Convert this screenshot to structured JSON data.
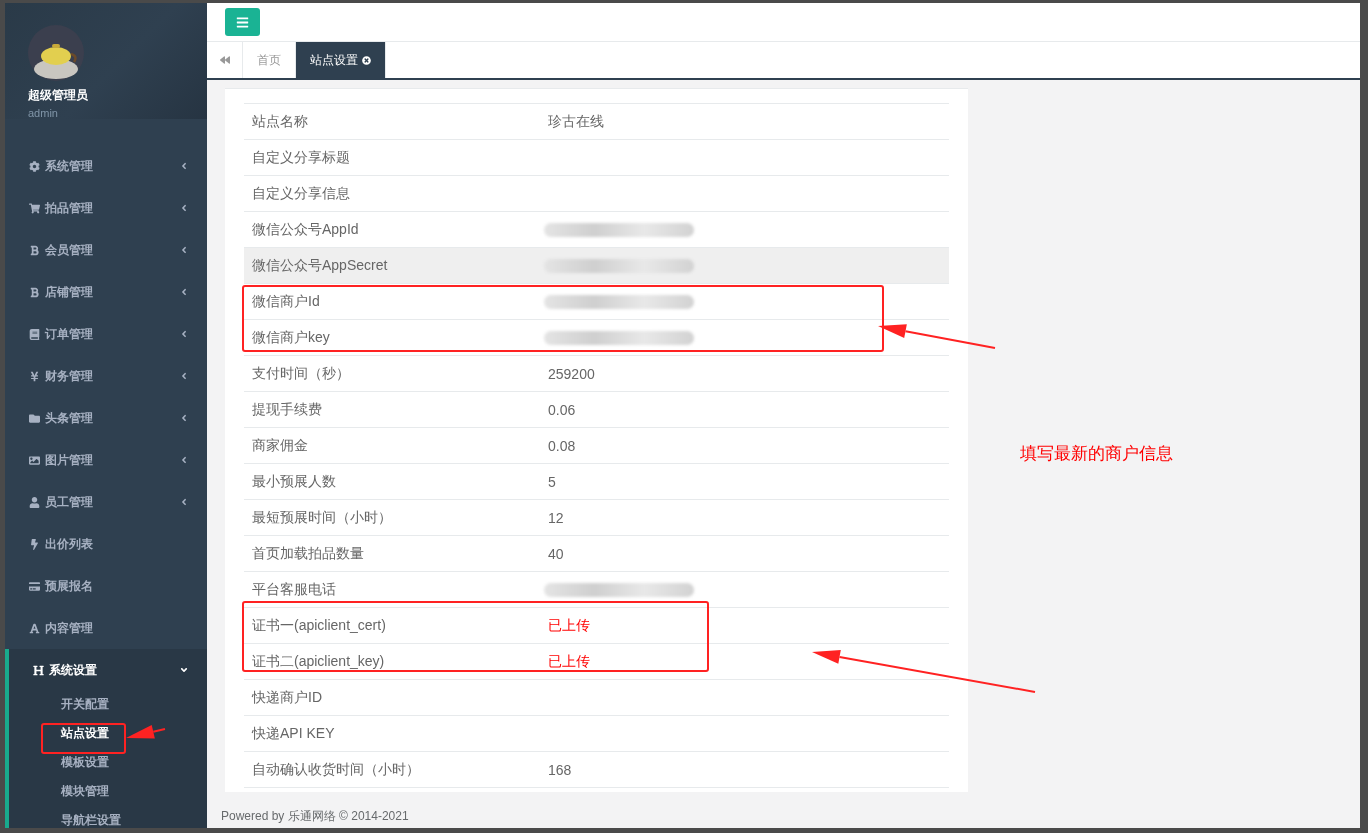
{
  "sidebar": {
    "profile": {
      "name": "超级管理员",
      "role": "admin"
    },
    "menu": [
      {
        "label": "系统管理",
        "expanded": false
      },
      {
        "label": "拍品管理",
        "expanded": false
      },
      {
        "label": "会员管理",
        "expanded": false
      },
      {
        "label": "店铺管理",
        "expanded": false
      },
      {
        "label": "订单管理",
        "expanded": false
      },
      {
        "label": "财务管理",
        "expanded": false
      },
      {
        "label": "头条管理",
        "expanded": false
      },
      {
        "label": "图片管理",
        "expanded": false
      },
      {
        "label": "员工管理",
        "expanded": false
      },
      {
        "label": "出价列表"
      },
      {
        "label": "预展报名"
      },
      {
        "label": "内容管理"
      },
      {
        "label": "系统设置",
        "expanded": true,
        "children": [
          {
            "label": "开关配置",
            "selected": false
          },
          {
            "label": "站点设置",
            "selected": true
          },
          {
            "label": "模板设置",
            "selected": false
          },
          {
            "label": "模块管理",
            "selected": false
          },
          {
            "label": "导航栏设置",
            "selected": false
          }
        ]
      }
    ]
  },
  "tabs": [
    {
      "label": "首页",
      "selected": false,
      "closable": false
    },
    {
      "label": "站点设置",
      "selected": true,
      "closable": true
    }
  ],
  "rows": [
    {
      "label": "站点名称",
      "value": "珍古在线",
      "kind": "text",
      "hover": false
    },
    {
      "label": "自定义分享标题",
      "kind": "empty",
      "hover": false
    },
    {
      "label": "自定义分享信息",
      "kind": "empty",
      "hover": false
    },
    {
      "label": "微信公众号AppId",
      "kind": "redacted",
      "hover": false
    },
    {
      "label": "微信公众号AppSecret",
      "kind": "redacted",
      "hover": true
    },
    {
      "label": "微信商户Id",
      "kind": "redacted",
      "hover": false
    },
    {
      "label": "微信商户key",
      "kind": "redacted",
      "hover": false
    },
    {
      "label": "支付时间（秒）",
      "value": "259200",
      "kind": "text",
      "hover": false
    },
    {
      "label": "提现手续费",
      "value": "0.06",
      "kind": "text",
      "hover": false
    },
    {
      "label": "商家佣金",
      "value": "0.08",
      "kind": "text",
      "hover": false
    },
    {
      "label": "最小预展人数",
      "value": "5",
      "kind": "text",
      "hover": false
    },
    {
      "label": "最短预展时间（小时）",
      "value": "12",
      "kind": "text",
      "hover": false
    },
    {
      "label": "首页加载拍品数量",
      "value": "40",
      "kind": "text",
      "hover": false
    },
    {
      "label": "平台客服电话",
      "kind": "redacted",
      "hover": false
    },
    {
      "label": "证书一(apiclient_cert)",
      "value": "已上传",
      "kind": "status",
      "hover": false
    },
    {
      "label": "证书二(apiclient_key)",
      "value": "已上传",
      "kind": "status",
      "hover": false
    },
    {
      "label": "快递商户ID",
      "kind": "empty",
      "hover": false
    },
    {
      "label": "快递API KEY",
      "kind": "empty",
      "hover": false
    },
    {
      "label": "自动确认收货时间（小时）",
      "value": "168",
      "kind": "text",
      "hover": false
    }
  ],
  "footer": "Powered by 乐通网络 © 2014-2021",
  "annotation": {
    "note": "填写最新的商户信息"
  }
}
